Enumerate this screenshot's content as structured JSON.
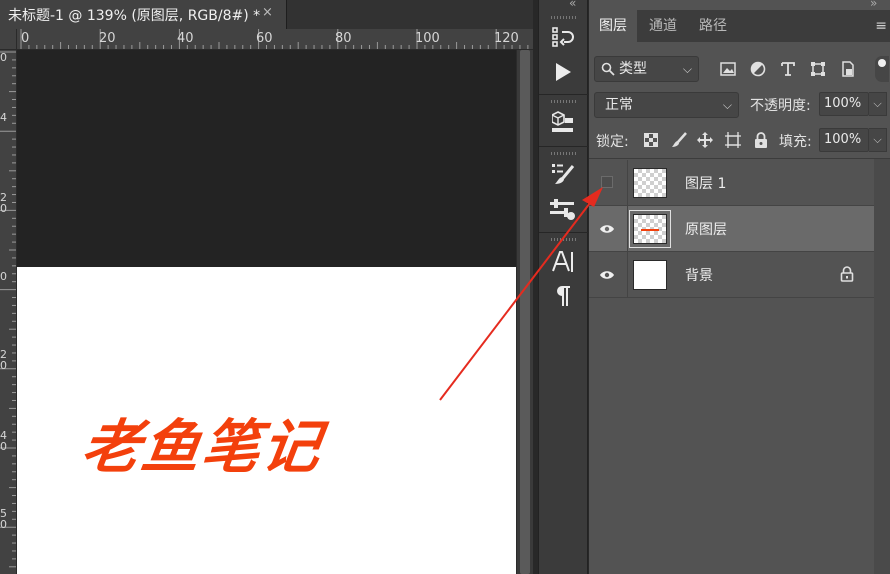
{
  "document": {
    "tab_title": "未标题-1 @ 139% (原图层, RGB/8#) *",
    "close_symbol": "×",
    "ruler_h_labels": [
      "0",
      "20",
      "40",
      "60",
      "80",
      "100",
      "120"
    ],
    "ruler_v_labels": [
      "0",
      "4",
      "2 0",
      "0",
      "2 0",
      "4 0",
      "5 0"
    ],
    "canvas_text": "老鱼笔记"
  },
  "tool_strip": {
    "tools": [
      {
        "name": "history-icon",
        "glyph": "⟲"
      },
      {
        "name": "play-icon",
        "glyph": "▶"
      },
      {
        "name": "3d-cube-icon",
        "glyph": "▣"
      },
      {
        "name": "brush-settings-icon",
        "glyph": "✎"
      },
      {
        "name": "adjustments-icon",
        "glyph": "⚌"
      },
      {
        "name": "character-icon",
        "glyph": "A|"
      },
      {
        "name": "paragraph-icon",
        "glyph": "¶"
      }
    ]
  },
  "layers_panel": {
    "tabs": [
      {
        "label": "图层",
        "active": true
      },
      {
        "label": "通道",
        "active": false
      },
      {
        "label": "路径",
        "active": false
      }
    ],
    "menu_symbol": "≡",
    "filter_kind": "类型",
    "blend_mode": "正常",
    "opacity_label": "不透明度:",
    "opacity_value": "100%",
    "lock_label": "锁定:",
    "fill_label": "填充:",
    "fill_value": "100%",
    "layers": [
      {
        "name": "图层 1",
        "visible": false,
        "selected": false,
        "thumb": "checker",
        "locked": false
      },
      {
        "name": "原图层",
        "visible": true,
        "selected": true,
        "thumb": "checker",
        "locked": false
      },
      {
        "name": "背景",
        "visible": true,
        "selected": false,
        "thumb": "white",
        "locked": true
      }
    ]
  },
  "colors": {
    "accent_text": "#f3400c",
    "annotation_arrow": "#e52b1f",
    "panel_bg": "#535353",
    "selected_row": "#6a6a6a"
  }
}
